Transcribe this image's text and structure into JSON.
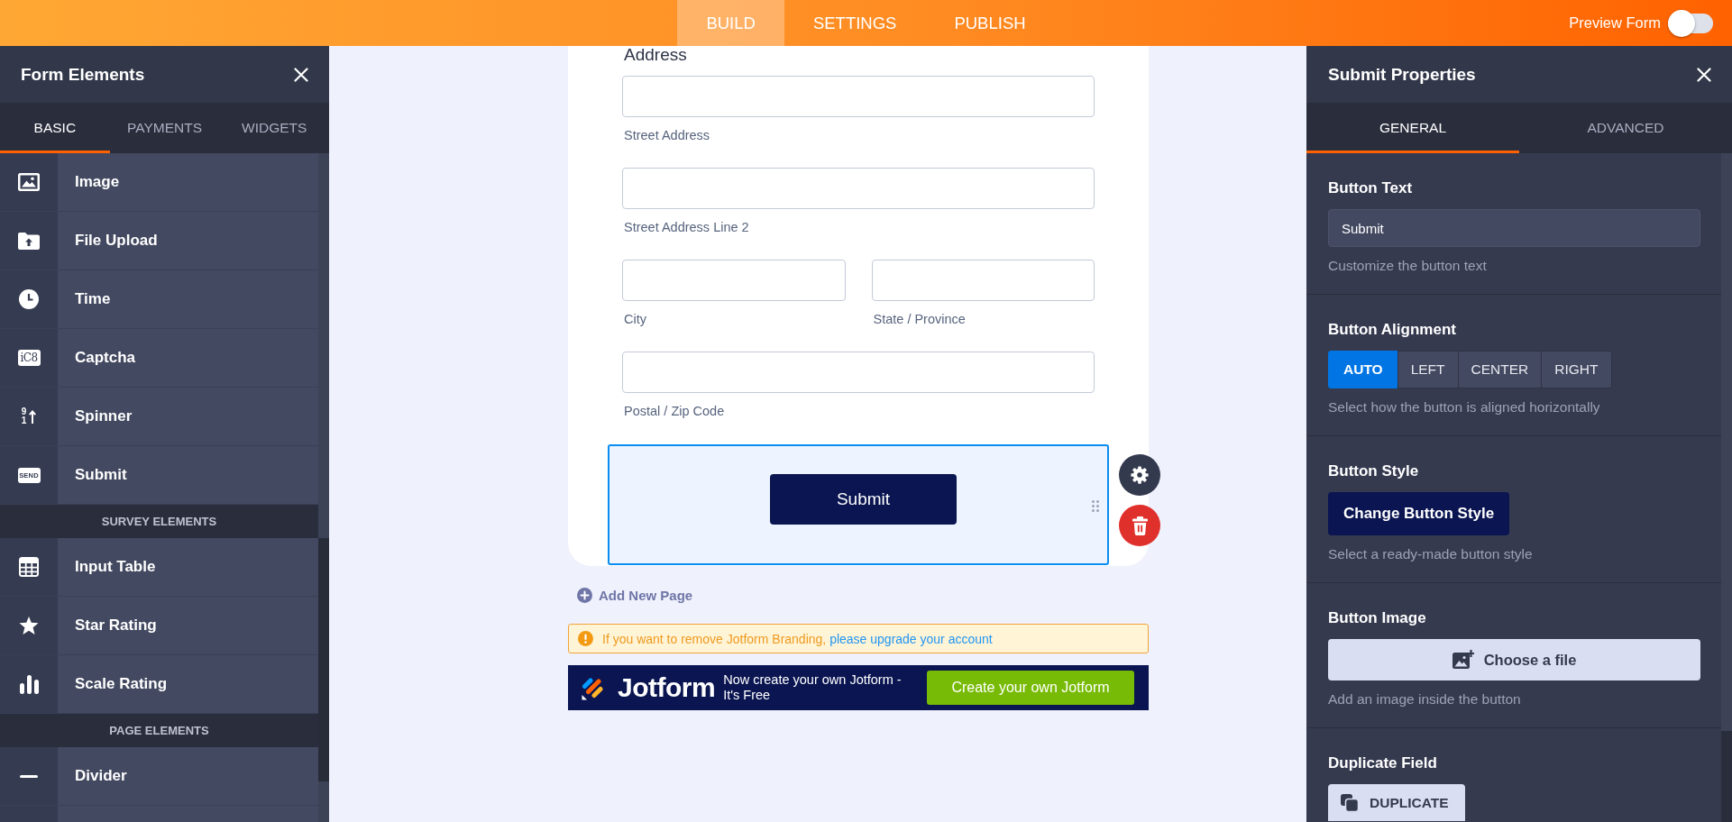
{
  "top_bar": {
    "nav": [
      {
        "label": "BUILD",
        "selected": true
      },
      {
        "label": "SETTINGS",
        "selected": false
      },
      {
        "label": "PUBLISH",
        "selected": false
      }
    ],
    "preview_form": {
      "label": "Preview Form",
      "on": false
    }
  },
  "form_elements": {
    "title": "Form Elements",
    "tabs": [
      {
        "label": "BASIC",
        "selected": true
      },
      {
        "label": "PAYMENTS",
        "selected": false
      },
      {
        "label": "WIDGETS",
        "selected": false
      }
    ],
    "sections": [
      {
        "items": [
          {
            "label": "Image"
          },
          {
            "label": "File Upload"
          },
          {
            "label": "Time"
          },
          {
            "label": "Captcha",
            "icon_text": "iC8"
          },
          {
            "label": "Spinner",
            "icon_digits": [
              "9",
              "1"
            ]
          },
          {
            "label": "Submit",
            "icon_text": "SEND"
          }
        ]
      },
      {
        "heading": "SURVEY ELEMENTS",
        "items": [
          {
            "label": "Input Table"
          },
          {
            "label": "Star Rating"
          },
          {
            "label": "Scale Rating"
          }
        ]
      },
      {
        "heading": "PAGE ELEMENTS",
        "items": [
          {
            "label": "Divider"
          }
        ]
      }
    ]
  },
  "form": {
    "section_title": "Address",
    "rows": [
      {
        "fields": [
          {
            "sublabel": "Street Address"
          }
        ]
      },
      {
        "fields": [
          {
            "sublabel": "Street Address Line 2"
          }
        ]
      },
      {
        "fields": [
          {
            "sublabel": "City"
          },
          {
            "sublabel": "State / Province"
          }
        ]
      },
      {
        "fields": [
          {
            "sublabel": "Postal / Zip Code"
          }
        ]
      }
    ],
    "submit_field": {
      "button": "Submit",
      "selected": true
    }
  },
  "add_page": {
    "label": "Add New Page"
  },
  "branding_notice": {
    "text": "If you want to remove Jotform Branding,",
    "link": "please upgrade your account"
  },
  "promo_banner": {
    "logo_text": "Jotform",
    "tagline": "Now create your own Jotform - It's Free",
    "button": "Create your own Jotform"
  },
  "properties": {
    "title": "Submit Properties",
    "tabs": [
      {
        "label": "GENERAL",
        "selected": true
      },
      {
        "label": "ADVANCED",
        "selected": false
      }
    ],
    "sections": [
      {
        "kind": "text_field",
        "title": "Button Text",
        "value": "Submit",
        "hint": "Customize the button text"
      },
      {
        "kind": "segmented",
        "title": "Button Alignment",
        "options": [
          {
            "label": "AUTO",
            "selected": true
          },
          {
            "label": "LEFT",
            "selected": false
          },
          {
            "label": "CENTER",
            "selected": false
          },
          {
            "label": "RIGHT",
            "selected": false
          }
        ],
        "hint": "Select how the button is aligned horizontally"
      },
      {
        "kind": "style_button",
        "title": "Button Style",
        "button": "Change Button Style",
        "hint": "Select a ready-made button style"
      },
      {
        "kind": "file_button",
        "title": "Button Image",
        "button": "Choose a file",
        "hint": "Add an image inside the button"
      },
      {
        "kind": "duplicate_button",
        "title": "Duplicate Field",
        "button": "DUPLICATE"
      }
    ]
  }
}
